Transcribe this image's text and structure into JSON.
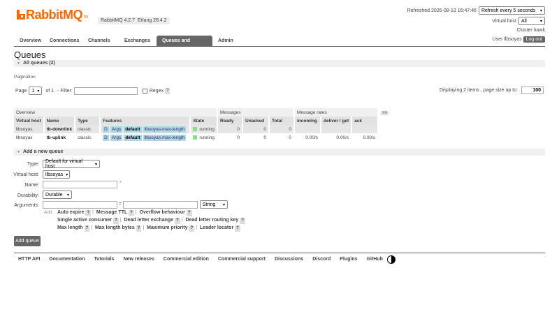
{
  "brand": {
    "logo_text": "RabbitMQ",
    "tm": "TM",
    "color": "#ff6600"
  },
  "versions": {
    "rabbitmq": "RabbitMQ 4.2.7",
    "erlang": "Erlang 28.4.2"
  },
  "status": {
    "refreshed": "Refreshed 2026-08-13 16:47:46",
    "refresh_select": "Refresh every 5 seconds",
    "vhost_label": "Virtual host",
    "vhost_select": "All",
    "cluster": "Cluster hawk",
    "user": "User llbsoyas",
    "logout": "Log out"
  },
  "nav": {
    "tabs": [
      "Overview",
      "Connections",
      "Channels",
      "Exchanges",
      "Queues and Streams",
      "Admin"
    ],
    "active": "Queues and Streams"
  },
  "page": {
    "title": "Queues",
    "all_queues": "All queues (2)"
  },
  "pagination": {
    "label": "Pagination",
    "page_label": "Page",
    "page_value": "1",
    "of": "of 1",
    "filter_label": "- Filter:",
    "regex_label": "Regex",
    "help": "?",
    "displaying": "Displaying 2 items , page size up to:",
    "page_size": "100"
  },
  "table": {
    "groups": {
      "overview": "Overview",
      "messages": "Messages",
      "rates": "Message rates",
      "toggle": "+/-"
    },
    "columns": [
      "Virtual host",
      "Name",
      "Type",
      "Features",
      "State",
      "Ready",
      "Unacked",
      "Total",
      "incoming",
      "deliver / get",
      "ack"
    ],
    "rows": [
      {
        "vhost": "llbsoyas",
        "name": "tb-downlink",
        "type": "classic",
        "f1": "D",
        "f2": "Args",
        "f3": "default",
        "f4": "llbsoyas-max-length",
        "state": "running",
        "ready": "0",
        "unacked": "0",
        "total": "0",
        "incoming": "",
        "deliver": "",
        "ack": ""
      },
      {
        "vhost": "llbsoyas",
        "name": "tb-uplink",
        "type": "classic",
        "f1": "D",
        "f2": "Args",
        "f3": "default",
        "f4": "llbsoyas-max-length",
        "state": "running",
        "ready": "0",
        "unacked": "0",
        "total": "0",
        "incoming": "0.00/s",
        "deliver": "0.00/s",
        "ack": "0.00/s"
      }
    ]
  },
  "add_queue": {
    "title": "Add a new queue",
    "type_label": "Type:",
    "type_value": "Default for virtual host",
    "vhost_label": "Virtual host:",
    "vhost_value": "llbsoyas",
    "name_label": "Name:",
    "name_star": "*",
    "durability_label": "Durability:",
    "durability_value": "Durable",
    "arguments_label": "Arguments:",
    "equals": "=",
    "arg_type": "String",
    "add_label": "Add",
    "args_row1": [
      "Auto expire",
      "Message TTL",
      "Overflow behaviour"
    ],
    "args_row2": [
      "Single active consumer",
      "Dead letter exchange",
      "Dead letter routing key"
    ],
    "args_row3": [
      "Max length",
      "Max length bytes",
      "Maximum priority",
      "Leader locator"
    ],
    "help": "?",
    "separator": "|",
    "submit": "Add queue"
  },
  "footer": [
    "HTTP API",
    "Documentation",
    "Tutorials",
    "New releases",
    "Commercial edition",
    "Commercial support",
    "Discussions",
    "Discord",
    "Plugins",
    "GitHub"
  ]
}
